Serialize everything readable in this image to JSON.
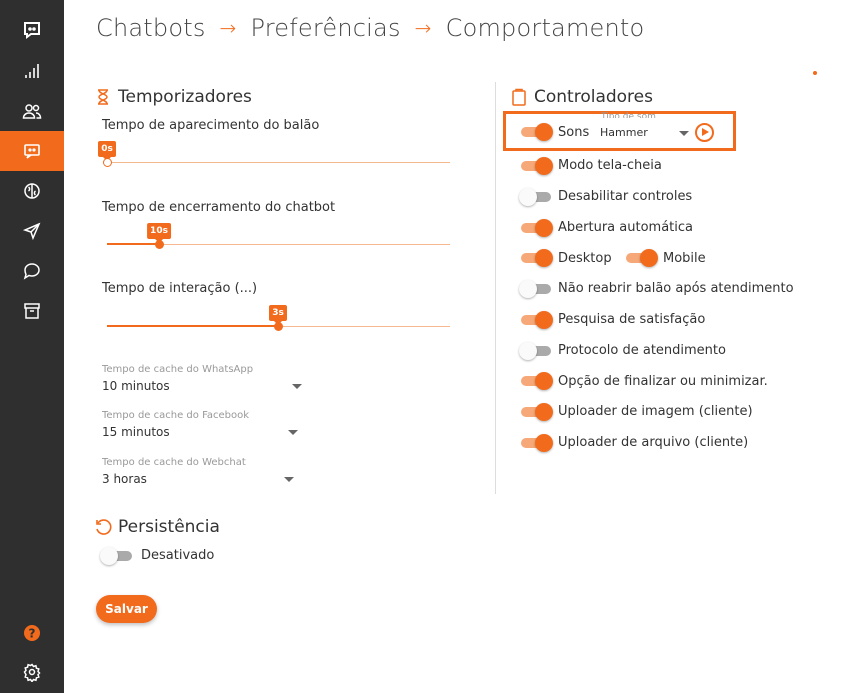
{
  "breadcrumb": [
    "Chatbots",
    "Preferências",
    "Comportamento"
  ],
  "breadcrumb_separator": "→",
  "sidebar": {
    "items": [
      {
        "icon": "chatbot-logo-icon",
        "active": false
      },
      {
        "icon": "bar-chart-icon",
        "active": false
      },
      {
        "icon": "users-icon",
        "active": false
      },
      {
        "icon": "chatbot-icon",
        "active": true
      },
      {
        "icon": "brain-icon",
        "active": false
      },
      {
        "icon": "paper-plane-icon",
        "active": false
      },
      {
        "icon": "chat-bubble-icon",
        "active": false
      },
      {
        "icon": "archive-icon",
        "active": false
      }
    ],
    "bottom": [
      {
        "icon": "help-icon"
      },
      {
        "icon": "gear-icon"
      }
    ]
  },
  "timers": {
    "title": "Temporizadores",
    "sliders": [
      {
        "label": "Tempo de aparecimento do balão",
        "value_label": "0s",
        "value": 0
      },
      {
        "label": "Tempo de encerramento do chatbot",
        "value_label": "10s",
        "value": 0.15
      },
      {
        "label": "Tempo de interação (...)",
        "value_label": "3s",
        "value": 0.5
      }
    ],
    "cache": [
      {
        "label": "Tempo de cache do WhatsApp",
        "value": "10 minutos"
      },
      {
        "label": "Tempo de cache do Facebook",
        "value": "15 minutos"
      },
      {
        "label": "Tempo de cache do Webchat",
        "value": "3 horas"
      }
    ]
  },
  "persistence": {
    "title": "Persistência",
    "toggle_label": "Desativado",
    "enabled": false
  },
  "controllers": {
    "title": "Controladores",
    "sound": {
      "label": "Sons",
      "enabled": true,
      "select_label": "Tipo de som",
      "select_value": "Hammer"
    },
    "items": [
      {
        "label": "Modo tela-cheia",
        "enabled": true
      },
      {
        "label": "Desabilitar controles",
        "enabled": false
      },
      {
        "label": "Abertura automática",
        "enabled": true
      },
      {
        "label": "Desktop",
        "enabled": true
      },
      {
        "label": "Mobile",
        "enabled": true
      },
      {
        "label": "Não reabrir balão após atendimento",
        "enabled": false
      },
      {
        "label": "Pesquisa de satisfação",
        "enabled": true
      },
      {
        "label": "Protocolo de atendimento",
        "enabled": false
      },
      {
        "label": "Opção de finalizar ou minimizar.",
        "enabled": true
      },
      {
        "label": "Uploader de imagem (cliente)",
        "enabled": true
      },
      {
        "label": "Uploader de arquivo (cliente)",
        "enabled": true
      }
    ]
  },
  "save_label": "Salvar",
  "colors": {
    "accent": "#f26b1d",
    "sidebar": "#2f2f2f"
  }
}
